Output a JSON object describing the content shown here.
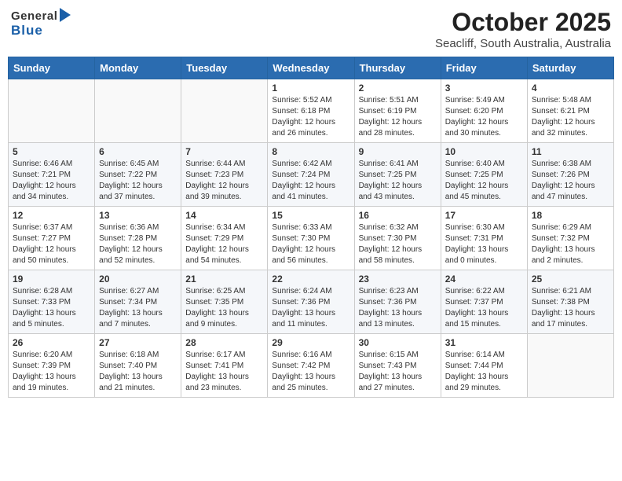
{
  "header": {
    "logo_general": "General",
    "logo_blue": "Blue",
    "title": "October 2025",
    "subtitle": "Seacliff, South Australia, Australia"
  },
  "calendar": {
    "weekdays": [
      "Sunday",
      "Monday",
      "Tuesday",
      "Wednesday",
      "Thursday",
      "Friday",
      "Saturday"
    ],
    "weeks": [
      [
        {
          "day": "",
          "info": ""
        },
        {
          "day": "",
          "info": ""
        },
        {
          "day": "",
          "info": ""
        },
        {
          "day": "1",
          "info": "Sunrise: 5:52 AM\nSunset: 6:18 PM\nDaylight: 12 hours\nand 26 minutes."
        },
        {
          "day": "2",
          "info": "Sunrise: 5:51 AM\nSunset: 6:19 PM\nDaylight: 12 hours\nand 28 minutes."
        },
        {
          "day": "3",
          "info": "Sunrise: 5:49 AM\nSunset: 6:20 PM\nDaylight: 12 hours\nand 30 minutes."
        },
        {
          "day": "4",
          "info": "Sunrise: 5:48 AM\nSunset: 6:21 PM\nDaylight: 12 hours\nand 32 minutes."
        }
      ],
      [
        {
          "day": "5",
          "info": "Sunrise: 6:46 AM\nSunset: 7:21 PM\nDaylight: 12 hours\nand 34 minutes."
        },
        {
          "day": "6",
          "info": "Sunrise: 6:45 AM\nSunset: 7:22 PM\nDaylight: 12 hours\nand 37 minutes."
        },
        {
          "day": "7",
          "info": "Sunrise: 6:44 AM\nSunset: 7:23 PM\nDaylight: 12 hours\nand 39 minutes."
        },
        {
          "day": "8",
          "info": "Sunrise: 6:42 AM\nSunset: 7:24 PM\nDaylight: 12 hours\nand 41 minutes."
        },
        {
          "day": "9",
          "info": "Sunrise: 6:41 AM\nSunset: 7:25 PM\nDaylight: 12 hours\nand 43 minutes."
        },
        {
          "day": "10",
          "info": "Sunrise: 6:40 AM\nSunset: 7:25 PM\nDaylight: 12 hours\nand 45 minutes."
        },
        {
          "day": "11",
          "info": "Sunrise: 6:38 AM\nSunset: 7:26 PM\nDaylight: 12 hours\nand 47 minutes."
        }
      ],
      [
        {
          "day": "12",
          "info": "Sunrise: 6:37 AM\nSunset: 7:27 PM\nDaylight: 12 hours\nand 50 minutes."
        },
        {
          "day": "13",
          "info": "Sunrise: 6:36 AM\nSunset: 7:28 PM\nDaylight: 12 hours\nand 52 minutes."
        },
        {
          "day": "14",
          "info": "Sunrise: 6:34 AM\nSunset: 7:29 PM\nDaylight: 12 hours\nand 54 minutes."
        },
        {
          "day": "15",
          "info": "Sunrise: 6:33 AM\nSunset: 7:30 PM\nDaylight: 12 hours\nand 56 minutes."
        },
        {
          "day": "16",
          "info": "Sunrise: 6:32 AM\nSunset: 7:30 PM\nDaylight: 12 hours\nand 58 minutes."
        },
        {
          "day": "17",
          "info": "Sunrise: 6:30 AM\nSunset: 7:31 PM\nDaylight: 13 hours\nand 0 minutes."
        },
        {
          "day": "18",
          "info": "Sunrise: 6:29 AM\nSunset: 7:32 PM\nDaylight: 13 hours\nand 2 minutes."
        }
      ],
      [
        {
          "day": "19",
          "info": "Sunrise: 6:28 AM\nSunset: 7:33 PM\nDaylight: 13 hours\nand 5 minutes."
        },
        {
          "day": "20",
          "info": "Sunrise: 6:27 AM\nSunset: 7:34 PM\nDaylight: 13 hours\nand 7 minutes."
        },
        {
          "day": "21",
          "info": "Sunrise: 6:25 AM\nSunset: 7:35 PM\nDaylight: 13 hours\nand 9 minutes."
        },
        {
          "day": "22",
          "info": "Sunrise: 6:24 AM\nSunset: 7:36 PM\nDaylight: 13 hours\nand 11 minutes."
        },
        {
          "day": "23",
          "info": "Sunrise: 6:23 AM\nSunset: 7:36 PM\nDaylight: 13 hours\nand 13 minutes."
        },
        {
          "day": "24",
          "info": "Sunrise: 6:22 AM\nSunset: 7:37 PM\nDaylight: 13 hours\nand 15 minutes."
        },
        {
          "day": "25",
          "info": "Sunrise: 6:21 AM\nSunset: 7:38 PM\nDaylight: 13 hours\nand 17 minutes."
        }
      ],
      [
        {
          "day": "26",
          "info": "Sunrise: 6:20 AM\nSunset: 7:39 PM\nDaylight: 13 hours\nand 19 minutes."
        },
        {
          "day": "27",
          "info": "Sunrise: 6:18 AM\nSunset: 7:40 PM\nDaylight: 13 hours\nand 21 minutes."
        },
        {
          "day": "28",
          "info": "Sunrise: 6:17 AM\nSunset: 7:41 PM\nDaylight: 13 hours\nand 23 minutes."
        },
        {
          "day": "29",
          "info": "Sunrise: 6:16 AM\nSunset: 7:42 PM\nDaylight: 13 hours\nand 25 minutes."
        },
        {
          "day": "30",
          "info": "Sunrise: 6:15 AM\nSunset: 7:43 PM\nDaylight: 13 hours\nand 27 minutes."
        },
        {
          "day": "31",
          "info": "Sunrise: 6:14 AM\nSunset: 7:44 PM\nDaylight: 13 hours\nand 29 minutes."
        },
        {
          "day": "",
          "info": ""
        }
      ]
    ]
  }
}
